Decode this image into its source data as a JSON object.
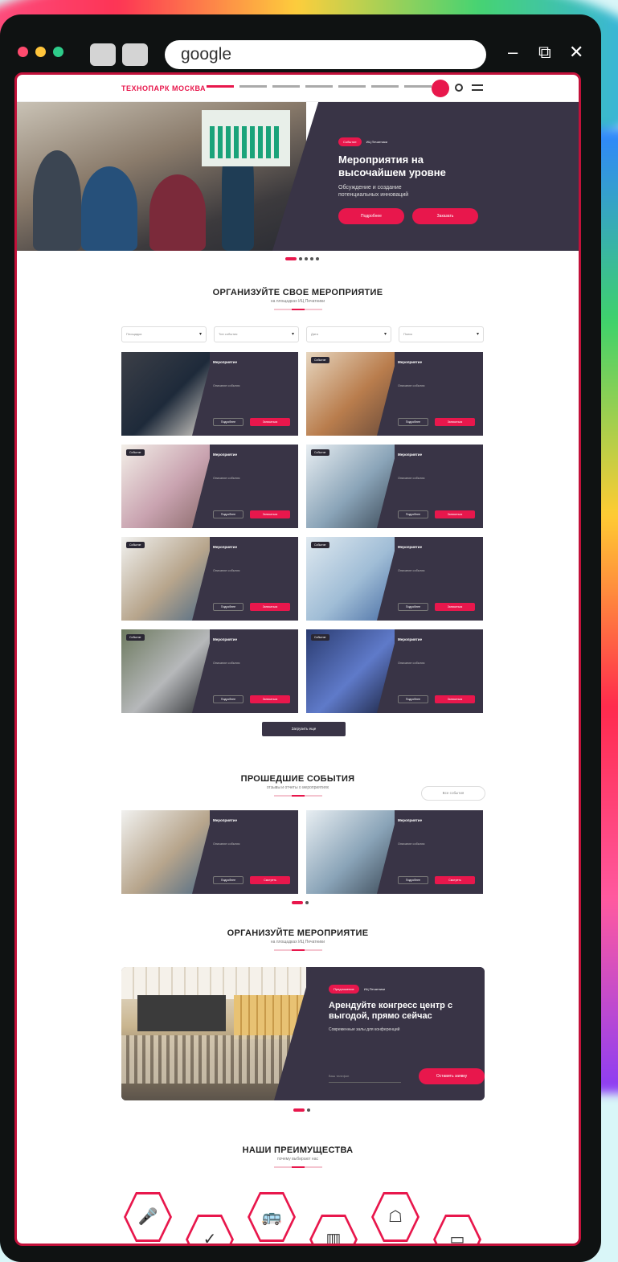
{
  "browser": {
    "url_text": "google",
    "window_controls": [
      "minimize-icon",
      "restore-icon",
      "close-icon"
    ],
    "traffic_dots": [
      "#ff4b6e",
      "#ffc53b",
      "#2ecc8a"
    ]
  },
  "site": {
    "hero": {
      "tag": "Событие",
      "tag_secondary": "ИЦ Печатники",
      "title": "Мероприятия на высочайшем уровне",
      "subtitle": "Обсуждение и создание потенциальных инноваций",
      "btn1": "Подробнее",
      "btn2": "Заказать"
    },
    "section1": {
      "title": "ОРГАНИЗУЙТЕ СВОЕ МЕРОПРИЯТИЕ",
      "subtitle": "на площадках ИЦ Печатники"
    },
    "filters": [
      "Площадка",
      "Тип события",
      "Дата",
      "Поиск"
    ],
    "cards": [
      {
        "badge": "",
        "title": "Мероприятие",
        "text": "Описание события",
        "b1": "Подробнее",
        "b2": "Записаться"
      },
      {
        "badge": "Событие",
        "title": "Мероприятие",
        "text": "Описание события",
        "b1": "Подробнее",
        "b2": "Записаться"
      },
      {
        "badge": "Событие",
        "title": "Мероприятие",
        "text": "Описание события",
        "b1": "Подробнее",
        "b2": "Записаться"
      },
      {
        "badge": "Событие",
        "title": "Мероприятие",
        "text": "Описание события",
        "b1": "Подробнее",
        "b2": "Записаться"
      },
      {
        "badge": "Событие",
        "title": "Мероприятие",
        "text": "Описание события",
        "b1": "Подробнее",
        "b2": "Записаться"
      },
      {
        "badge": "Событие",
        "title": "Мероприятие",
        "text": "Описание события",
        "b1": "Подробнее",
        "b2": "Записаться"
      },
      {
        "badge": "Событие",
        "title": "Мероприятие",
        "text": "Описание события",
        "b1": "Подробнее",
        "b2": "Записаться"
      },
      {
        "badge": "Событие",
        "title": "Мероприятие",
        "text": "Описание события",
        "b1": "Подробнее",
        "b2": "Записаться"
      }
    ],
    "more_btn": "Загрузить еще",
    "section2": {
      "title": "ПРОШЕДШИЕ СОБЫТИЯ",
      "subtitle": "отзывы и отчеты о мероприятиях",
      "archive": "Все события"
    },
    "past_cards": [
      {
        "badge": "",
        "title": "Мероприятие",
        "text": "Описание события",
        "b1": "Подробнее",
        "b2": "Смотреть"
      },
      {
        "badge": "",
        "title": "Мероприятие",
        "text": "Описание события",
        "b1": "Подробнее",
        "b2": "Смотреть"
      }
    ],
    "section3": {
      "title": "ОРГАНИЗУЙТЕ МЕРОПРИЯТИЕ",
      "subtitle": "на площадках ИЦ Печатники"
    },
    "promo": {
      "tag": "Предложение",
      "tag_secondary": "ИЦ Печатники",
      "title": "Арендуйте конгресс центр с выгодой, прямо сейчас",
      "text": "Современные залы для конференций",
      "field1": "Ваш телефон",
      "btn": "Оставить заявку"
    },
    "section4": {
      "title": "НАШИ ПРЕИМУЩЕСТВА",
      "subtitle": "почему выбирают нас"
    },
    "advantages": [
      "microphone-icon",
      "shield-check-icon",
      "bus-icon",
      "hall-icon",
      "cloche-icon",
      "sofa-icon"
    ],
    "accent": "#e8174c",
    "dark": "#393446"
  }
}
